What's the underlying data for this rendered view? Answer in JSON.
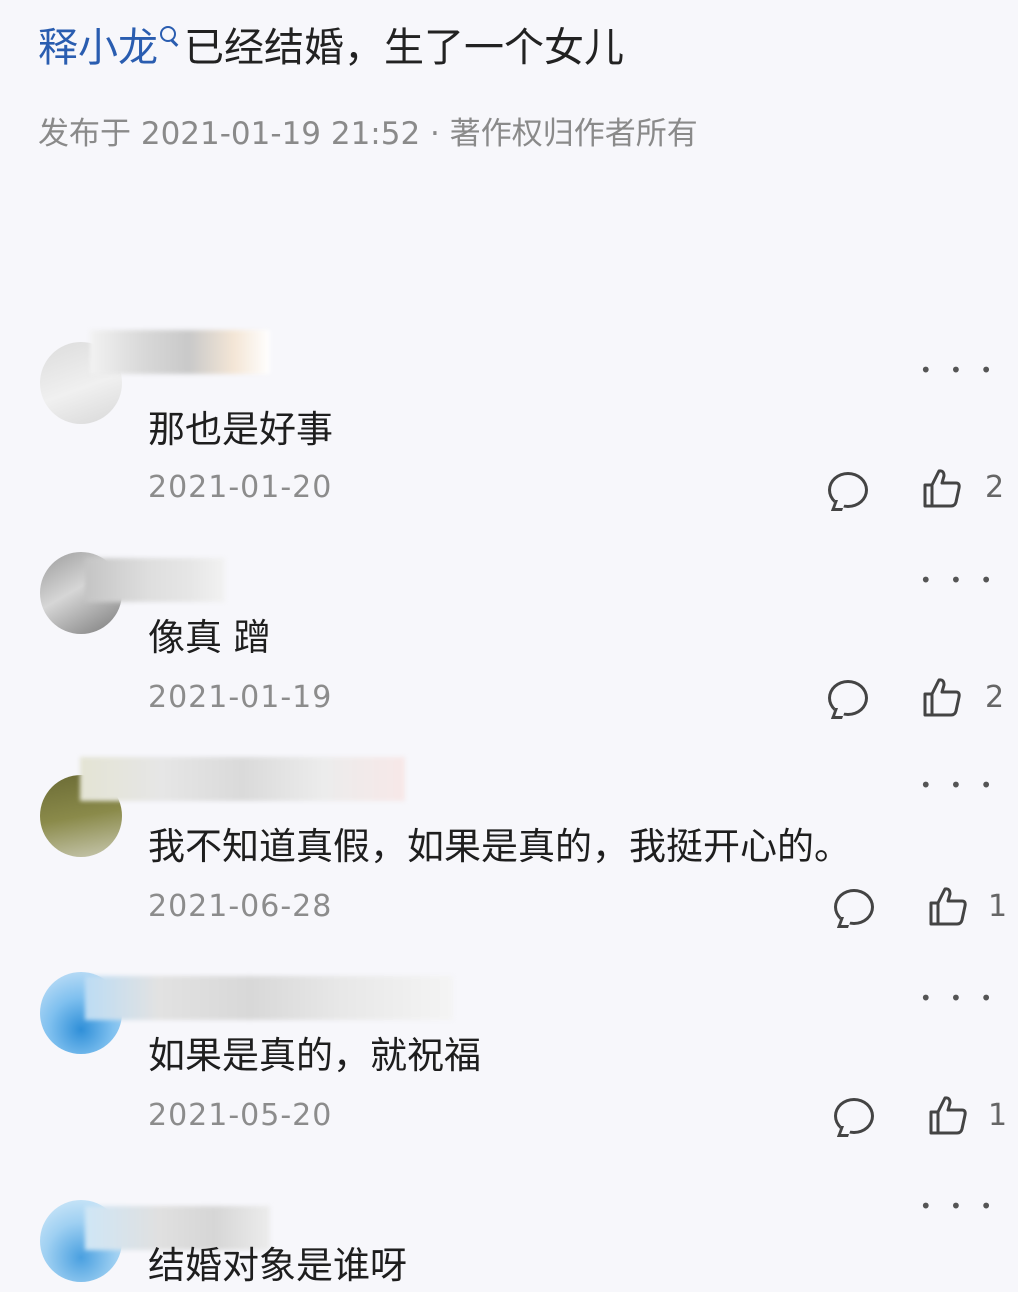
{
  "title": {
    "link_text": "释小龙",
    "rest_text": "已经结婚，生了一个女儿"
  },
  "meta": {
    "published": "发布于 2021-01-19 21:52 · 著作权归作者所有"
  },
  "comments": [
    {
      "text": "那也是好事",
      "date": "2021-01-20",
      "likes": "2"
    },
    {
      "text": "像真 蹭",
      "date": "2021-01-19",
      "likes": "2"
    },
    {
      "text": "我不知道真假，如果是真的，我挺开心的。",
      "date": "2021-06-28",
      "likes": "1"
    },
    {
      "text": "如果是真的，就祝福",
      "date": "2021-05-20",
      "likes": "1"
    },
    {
      "text": "结婚对象是谁呀"
    }
  ],
  "icons": {
    "more": "more-dots-icon",
    "reply": "comment-bubble-icon",
    "like": "thumbs-up-icon",
    "search": "search-icon"
  },
  "colors": {
    "link": "#2a5db0",
    "background": "#f7f7fb",
    "meta_text": "#8a8a8a"
  }
}
